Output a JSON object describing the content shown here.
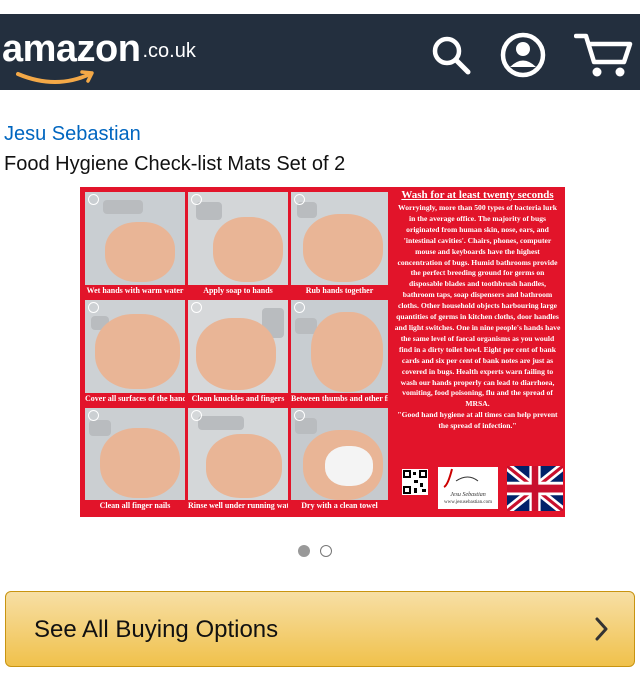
{
  "header": {
    "logo_text": "amazon",
    "logo_tld": ".co.uk",
    "bg_color": "#232f3e",
    "icons": [
      "search-icon",
      "account-icon",
      "cart-icon"
    ]
  },
  "product": {
    "brand": "Jesu Sebastian",
    "title": "Food Hygiene Check-list Mats Set of 2"
  },
  "image": {
    "step_captions": [
      "Wet hands with warm water",
      "Apply soap to hands",
      "Rub hands together",
      "Cover all surfaces of the hands",
      "Clean knuckles and fingers",
      "Between thumbs and other fingers",
      "Clean all finger nails",
      "Rinse well under running water",
      "Dry with a clean towel"
    ],
    "panel_heading": "Wash for at least twenty seconds",
    "panel_text": "Worryingly, more than 500 types of bacteria lurk in the average office. The majority of bugs originated from human skin, nose, ears, and 'intestinal cavities'. Chairs, phones, computer mouse and keyboards have the highest concentration of bugs. Humid bathrooms provide the perfect breeding ground for germs on disposable blades and toothbrush handles, bathroom taps, soap dispensers and bathroom cloths. Other household objects harbouring large quantities of germs in kitchen cloths, door handles and light switches. One in nine people's hands have the same level of faecal organisms as you would find in a dirty toilet bowl. Eight per cent of bank cards and six per cent of bank notes are just as covered in bugs. Health experts warn failing to wash our hands properly can lead to diarrhoea, vomiting, food poisoning, flu and the spread of MRSA.",
    "panel_quote": "\"Good hand hygiene at all times can help prevent the spread of infection.\"",
    "signature": "Jesu Sebastian",
    "website": "www.jesusebastian.com",
    "mat_color": "#e2142a"
  },
  "carousel": {
    "total": 2,
    "active_index": 0
  },
  "cta": {
    "label": "See All Buying Options",
    "color": "#f0c14b"
  }
}
